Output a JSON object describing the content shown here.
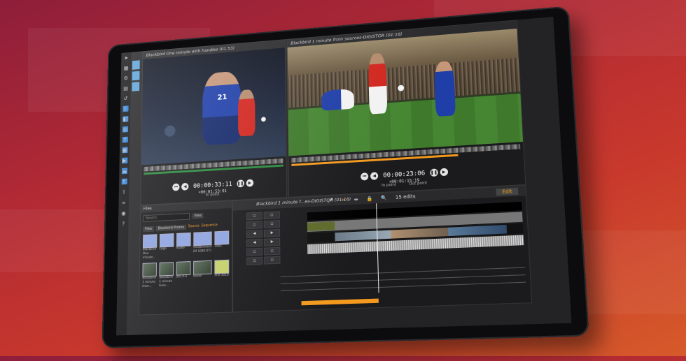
{
  "left_viewer": {
    "title": "Blackbird One minute with handles (01:53)",
    "timecode": "00:00:33:11",
    "offset": "+00:01:53:01",
    "in_label": "In point",
    "out_label": "Out point",
    "jersey_number": "21"
  },
  "right_viewer": {
    "title": "Blackbird 1 minute from sources-DIGISTOR (01:16)",
    "timecode": "00:00:23:06",
    "offset": "+00:01:15:19",
    "in_label": "In point",
    "out_label": "Out point"
  },
  "bin_panel": {
    "title": "Files",
    "search_placeholder": "Search",
    "filter": "Files",
    "tabs": [
      "Files",
      "Blackbird Promo"
    ],
    "options": [
      "Source",
      "Sequence"
    ],
    "row1": [
      "Blackbird One minute...",
      "Logo",
      "Audio",
      "Shutterstock (M 1080-07)",
      "Stills"
    ],
    "row2": [
      "Blackbird 1 minute from...",
      "Blackbird 1 minute from...",
      "Blackbird 1 minute from...",
      "0017HT",
      "Seven",
      "Shutterstock 4K FX files"
    ],
    "row2_extra": "dne 2018"
  },
  "timeline": {
    "title": "Blackbird 1 minute f...es-DIGISTOR (01:16)",
    "edits": "15 edits",
    "edit_button": "Edit"
  },
  "colors": {
    "accent_orange": "#f39a1e",
    "accent_blue": "#2e7fd6",
    "bin_purple": "#8ea3e0"
  }
}
